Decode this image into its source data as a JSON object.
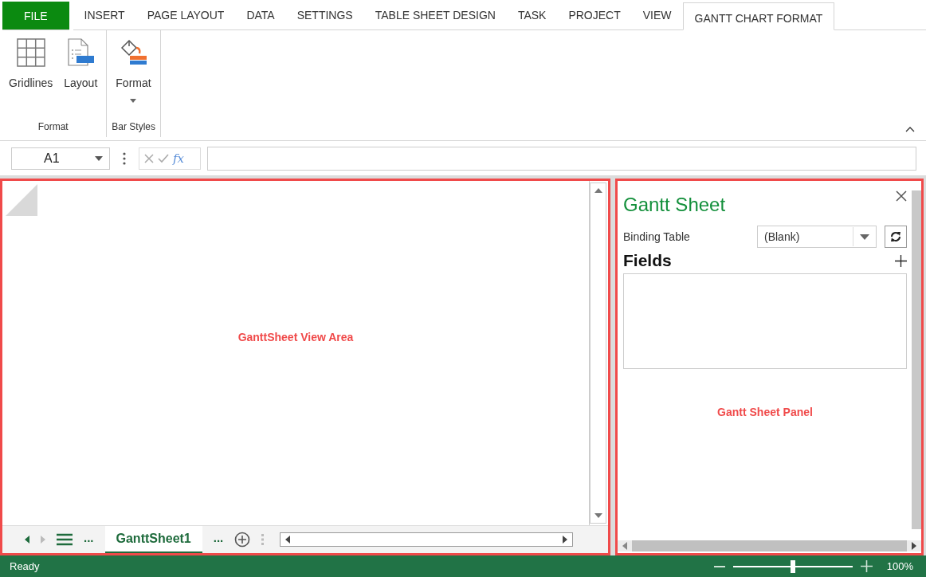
{
  "tabs": [
    {
      "label": "FILE",
      "kind": "file",
      "selected": false
    },
    {
      "label": "INSERT",
      "kind": "tab",
      "selected": false
    },
    {
      "label": "PAGE LAYOUT",
      "kind": "tab",
      "selected": false
    },
    {
      "label": "DATA",
      "kind": "tab",
      "selected": false
    },
    {
      "label": "SETTINGS",
      "kind": "tab",
      "selected": false
    },
    {
      "label": "TABLE SHEET DESIGN",
      "kind": "tab",
      "selected": false
    },
    {
      "label": "TASK",
      "kind": "tab",
      "selected": false
    },
    {
      "label": "PROJECT",
      "kind": "tab",
      "selected": false
    },
    {
      "label": "VIEW",
      "kind": "tab",
      "selected": false
    },
    {
      "label": "GANTT CHART FORMAT",
      "kind": "tab",
      "selected": true
    }
  ],
  "ribbon": {
    "groups": [
      {
        "label": "Format",
        "buttons": [
          {
            "label": "Gridlines",
            "kind": "grid"
          },
          {
            "label": "Layout",
            "kind": "layout"
          }
        ]
      },
      {
        "label": "Bar Styles",
        "buttons": [
          {
            "label": "Format",
            "kind": "paint"
          }
        ]
      }
    ]
  },
  "formula_bar": {
    "name_box": "A1",
    "fx": "fx"
  },
  "view_area": {
    "annotation": "GanttSheet View Area",
    "more_left": "...",
    "more_right": "...",
    "sheet_tabs": [
      {
        "label": "GanttSheet1",
        "selected": true
      }
    ]
  },
  "panel": {
    "title": "Gantt Sheet",
    "binding_label": "Binding Table",
    "binding_value": "(Blank)",
    "fields_title": "Fields",
    "annotation": "Gantt Sheet Panel"
  },
  "status_bar": {
    "status": "Ready",
    "zoom": {
      "level": 0.5,
      "reading": "100%"
    }
  }
}
